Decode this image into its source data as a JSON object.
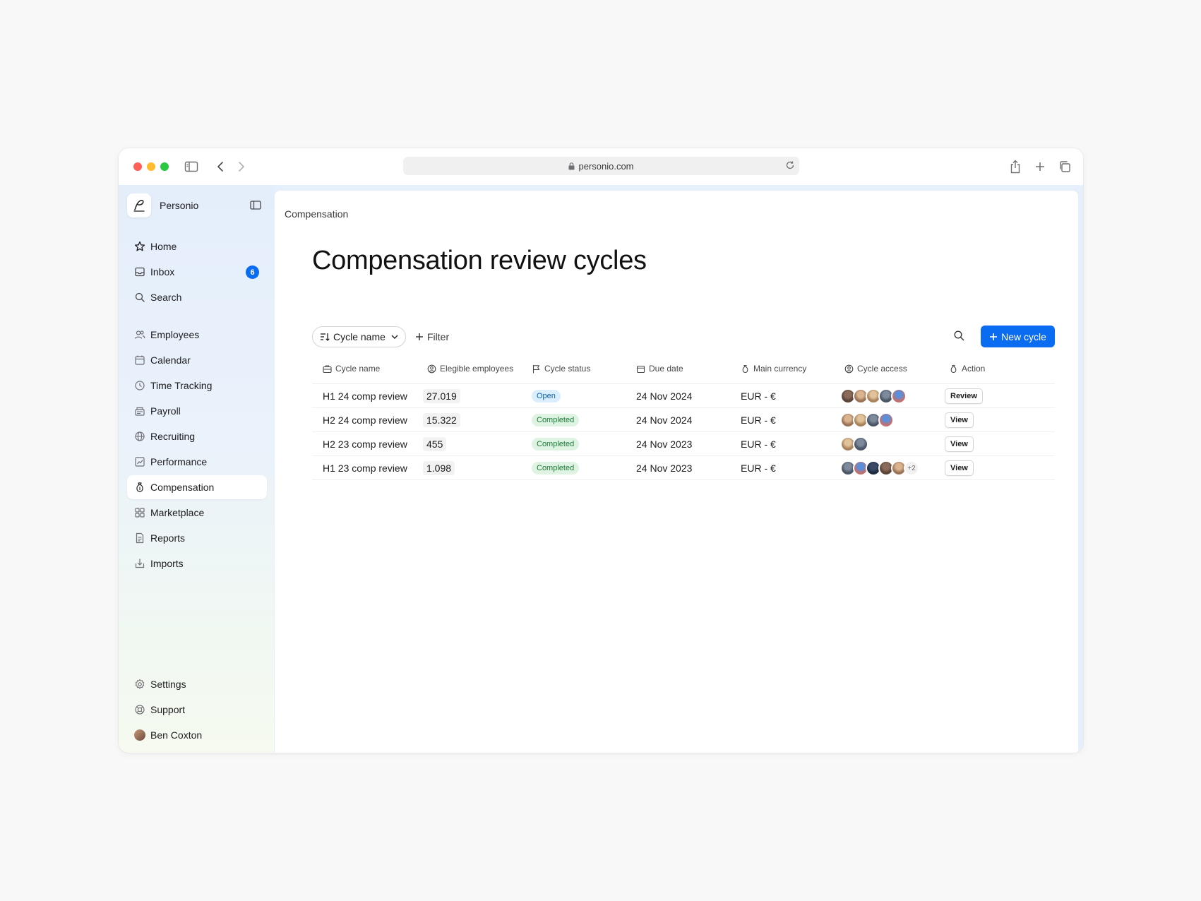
{
  "browser": {
    "url": "personio.com"
  },
  "sidebar": {
    "brand_name": "Personio",
    "top_items": [
      {
        "label": "Home",
        "icon": "star-icon"
      },
      {
        "label": "Inbox",
        "icon": "inbox-icon",
        "badge": "6"
      },
      {
        "label": "Search",
        "icon": "search-icon"
      }
    ],
    "items": [
      {
        "label": "Employees",
        "icon": "people-icon"
      },
      {
        "label": "Calendar",
        "icon": "calendar-icon"
      },
      {
        "label": "Time Tracking",
        "icon": "clock-icon"
      },
      {
        "label": "Payroll",
        "icon": "payroll-icon"
      },
      {
        "label": "Recruiting",
        "icon": "globe-icon"
      },
      {
        "label": "Performance",
        "icon": "chart-icon"
      },
      {
        "label": "Compensation",
        "icon": "moneybag-icon",
        "active": true
      },
      {
        "label": "Marketplace",
        "icon": "grid-icon"
      },
      {
        "label": "Reports",
        "icon": "document-icon"
      },
      {
        "label": "Imports",
        "icon": "import-icon"
      }
    ],
    "bottom_items": [
      {
        "label": "Settings",
        "icon": "gear-icon"
      },
      {
        "label": "Support",
        "icon": "lifebuoy-icon"
      },
      {
        "label": "Ben Coxton",
        "icon": "avatar"
      }
    ]
  },
  "main": {
    "breadcrumb": "Compensation",
    "title": "Compensation review cycles",
    "sort_label": "Cycle name",
    "filter_label": "Filter",
    "new_button_label": "New cycle",
    "table": {
      "columns": [
        "Cycle name",
        "Elegible employees",
        "Cycle status",
        "Due date",
        "Main currency",
        "Cycle access",
        "Action"
      ],
      "rows": [
        {
          "name": "H1 24 comp review",
          "employees": "27.019",
          "status": "Open",
          "due": "24 Nov 2024",
          "currency": "EUR - €",
          "avatar_count": 5,
          "more": "",
          "action": "Review"
        },
        {
          "name": "H2 24 comp review",
          "employees": "15.322",
          "status": "Completed",
          "due": "24 Nov 2024",
          "currency": "EUR - €",
          "avatar_count": 4,
          "more": "",
          "action": "View"
        },
        {
          "name": "H2 23 comp review",
          "employees": "455",
          "status": "Completed",
          "due": "24 Nov 2023",
          "currency": "EUR - €",
          "avatar_count": 2,
          "more": "",
          "action": "View"
        },
        {
          "name": "H1 23 comp review",
          "employees": "1.098",
          "status": "Completed",
          "due": "24 Nov 2023",
          "currency": "EUR - €",
          "avatar_count": 5,
          "more": "+2",
          "action": "View"
        }
      ]
    }
  },
  "colors": {
    "accent": "#0a6cf0",
    "status_open_bg": "#dbeeff",
    "status_completed_bg": "#dff3e3"
  }
}
